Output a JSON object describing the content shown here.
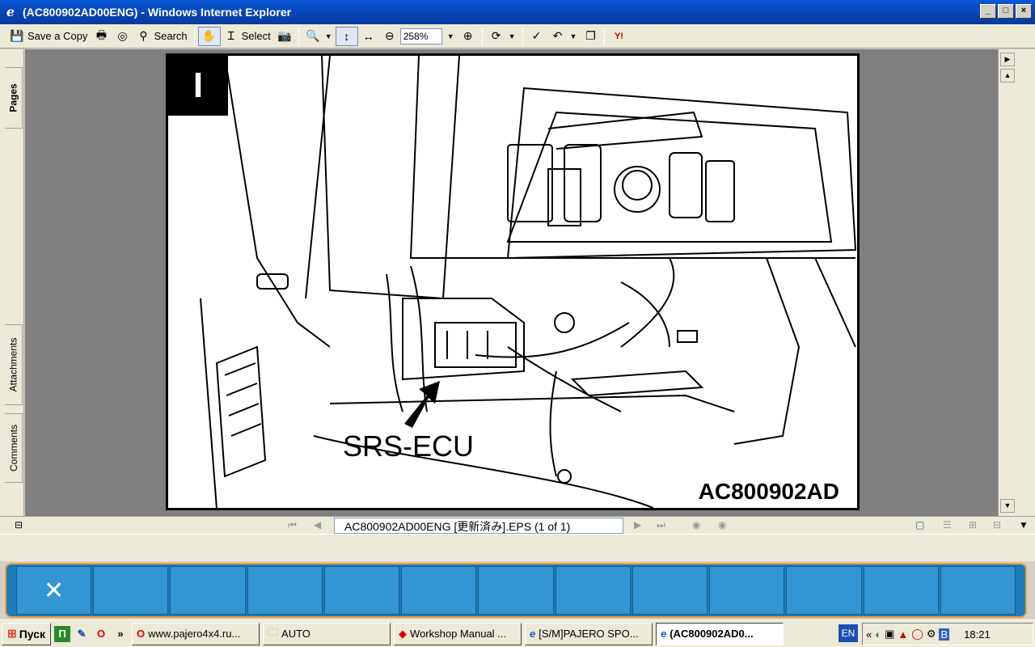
{
  "window": {
    "title": "(AC800902AD00ENG) - Windows Internet Explorer",
    "controls": {
      "minimize": "_",
      "maximize": "□",
      "close": "×"
    }
  },
  "toolbar": {
    "save_copy": "Save a Copy",
    "search": "Search",
    "select": "Select",
    "zoom": "258%"
  },
  "left_tabs": {
    "pages": "Pages",
    "attachments": "Attachments",
    "comments": "Comments"
  },
  "document": {
    "badge": "I",
    "callout": "SRS-ECU",
    "figure_code": "AC800902AD"
  },
  "statusbar": {
    "page_field": "AC800902AD00ENG [更新済み].EPS  (1 of 1)"
  },
  "taskbar": {
    "start": "Пуск",
    "tasks": [
      {
        "label": "www.pajero4x4.ru..."
      },
      {
        "label": "AUTO"
      },
      {
        "label": "Workshop Manual ..."
      },
      {
        "label": "[S/M]PAJERO SPO..."
      },
      {
        "label": "(AC800902AD0..."
      }
    ],
    "lang": "EN",
    "clock": "18:21"
  }
}
